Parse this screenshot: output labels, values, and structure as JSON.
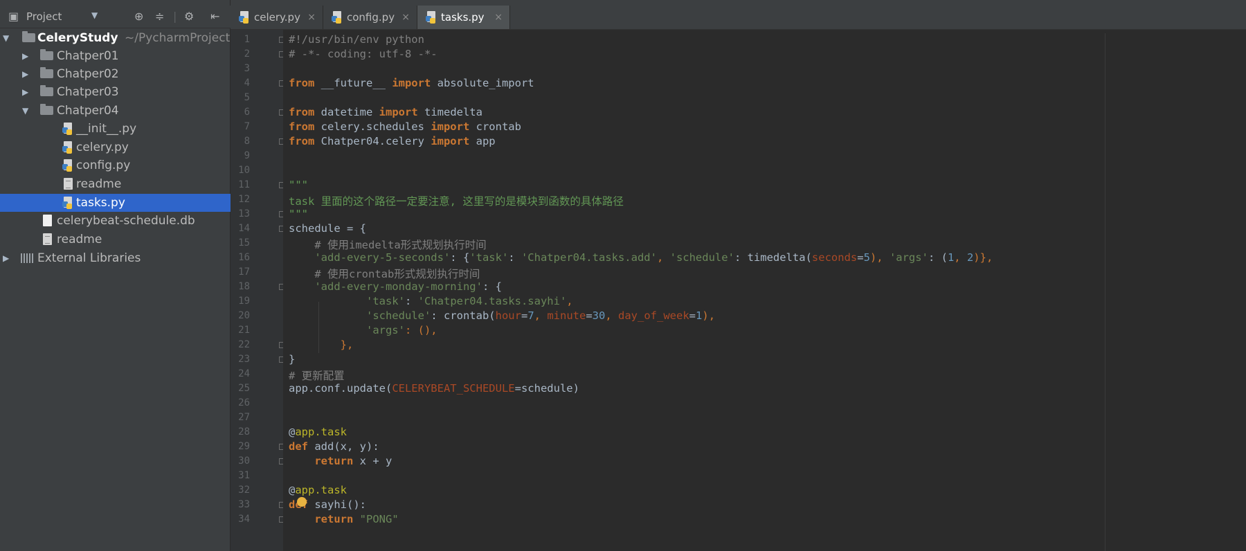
{
  "sidebar": {
    "header_label": "Project",
    "tree": [
      {
        "label": "CeleryStudy",
        "suffix": "~/PycharmProject",
        "type": "folder",
        "expanded": true
      },
      {
        "label": "Chatper01",
        "type": "folder",
        "expanded": false
      },
      {
        "label": "Chatper02",
        "type": "folder",
        "expanded": false
      },
      {
        "label": "Chatper03",
        "type": "folder",
        "expanded": false
      },
      {
        "label": "Chatper04",
        "type": "folder",
        "expanded": true
      },
      {
        "label": "__init__.py",
        "type": "python"
      },
      {
        "label": "celery.py",
        "type": "python"
      },
      {
        "label": "config.py",
        "type": "python"
      },
      {
        "label": "readme",
        "type": "text"
      },
      {
        "label": "tasks.py",
        "type": "python",
        "selected": true
      },
      {
        "label": "celerybeat-schedule.db",
        "type": "db"
      },
      {
        "label": "readme",
        "type": "text"
      },
      {
        "label": "External Libraries",
        "type": "library",
        "expanded": false
      }
    ]
  },
  "tabs": [
    {
      "label": "celery.py",
      "close": "×",
      "active": false
    },
    {
      "label": "config.py",
      "close": "×",
      "active": false
    },
    {
      "label": "tasks.py",
      "close": "×",
      "active": true
    }
  ],
  "editor": {
    "line_numbers": [
      "1",
      "2",
      "3",
      "4",
      "5",
      "6",
      "7",
      "8",
      "9",
      "10",
      "11",
      "12",
      "13",
      "14",
      "15",
      "16",
      "17",
      "18",
      "19",
      "20",
      "21",
      "22",
      "23",
      "24",
      "25",
      "26",
      "27",
      "28",
      "29",
      "30",
      "31",
      "32",
      "33",
      "34"
    ],
    "lines": {
      "l1": "#!/usr/bin/env python",
      "l2": "# -*- coding: utf-8 -*-",
      "l4a": "from",
      "l4b": " __future__ ",
      "l4c": "import",
      "l4d": " absolute_import",
      "l6a": "from",
      "l6b": " datetime ",
      "l6c": "import",
      "l6d": " timedelta",
      "l7a": "from",
      "l7b": " celery.schedules ",
      "l7c": "import",
      "l7d": " crontab",
      "l8a": "from",
      "l8b": " Chatper04.celery ",
      "l8c": "import",
      "l8d": " app",
      "l11": "\"\"\"",
      "l12": "task 里面的这个路径一定要注意, 这里写的是模块到函数的具体路径",
      "l13": "\"\"\"",
      "l14": "schedule = {",
      "l15": "    # 使用imedelta形式规划执行时间",
      "l16a": "    'add-every-5-seconds'",
      "l16b": ": {",
      "l16c": "'task'",
      "l16d": ": ",
      "l16e": "'Chatper04.tasks.add'",
      "l16f": ", ",
      "l16g": "'schedule'",
      "l16h": ": timedelta(",
      "l16i": "seconds",
      "l16j": "=",
      "l16k": "5",
      "l16l": "), ",
      "l16m": "'args'",
      "l16n": ": (",
      "l16o": "1",
      "l16p": ", ",
      "l16q": "2",
      "l16r": ")},",
      "l17": "    # 使用crontab形式规划执行时间",
      "l18a": "    'add-every-monday-morning'",
      "l18b": ": {",
      "l19a": "            'task'",
      "l19b": ": ",
      "l19c": "'Chatper04.tasks.sayhi'",
      "l19d": ",",
      "l20a": "            'schedule'",
      "l20b": ": crontab(",
      "l20c": "hour",
      "l20d": "=",
      "l20e": "7",
      "l20f": ", ",
      "l20g": "minute",
      "l20h": "=",
      "l20i": "30",
      "l20j": ", ",
      "l20k": "day_of_week",
      "l20l": "=",
      "l20m": "1",
      "l20n": "),",
      "l21a": "            'args'",
      "l21b": ": (),",
      "l22": "        },",
      "l23": "}",
      "l24": "# 更新配置",
      "l25a": "app.conf.update(",
      "l25b": "CELERYBEAT_SCHEDULE",
      "l25c": "=schedule)",
      "l28a": "@",
      "l28b": "app.task",
      "l29a": "def",
      "l29b": " add",
      "l29c": "(x, y):",
      "l30a": "    return",
      "l30b": " x + y",
      "l32a": "@",
      "l32b": "app.task",
      "l33a": "def",
      "l33b": " sayhi",
      "l33c": "():",
      "l34a": "    return",
      "l34b": " ",
      "l34c": "\"PONG\""
    }
  },
  "colors": {
    "keyword": "#cc7832",
    "string": "#6a8759",
    "comment": "#808080",
    "selection": "#2f65ca",
    "background": "#2b2b2b"
  }
}
